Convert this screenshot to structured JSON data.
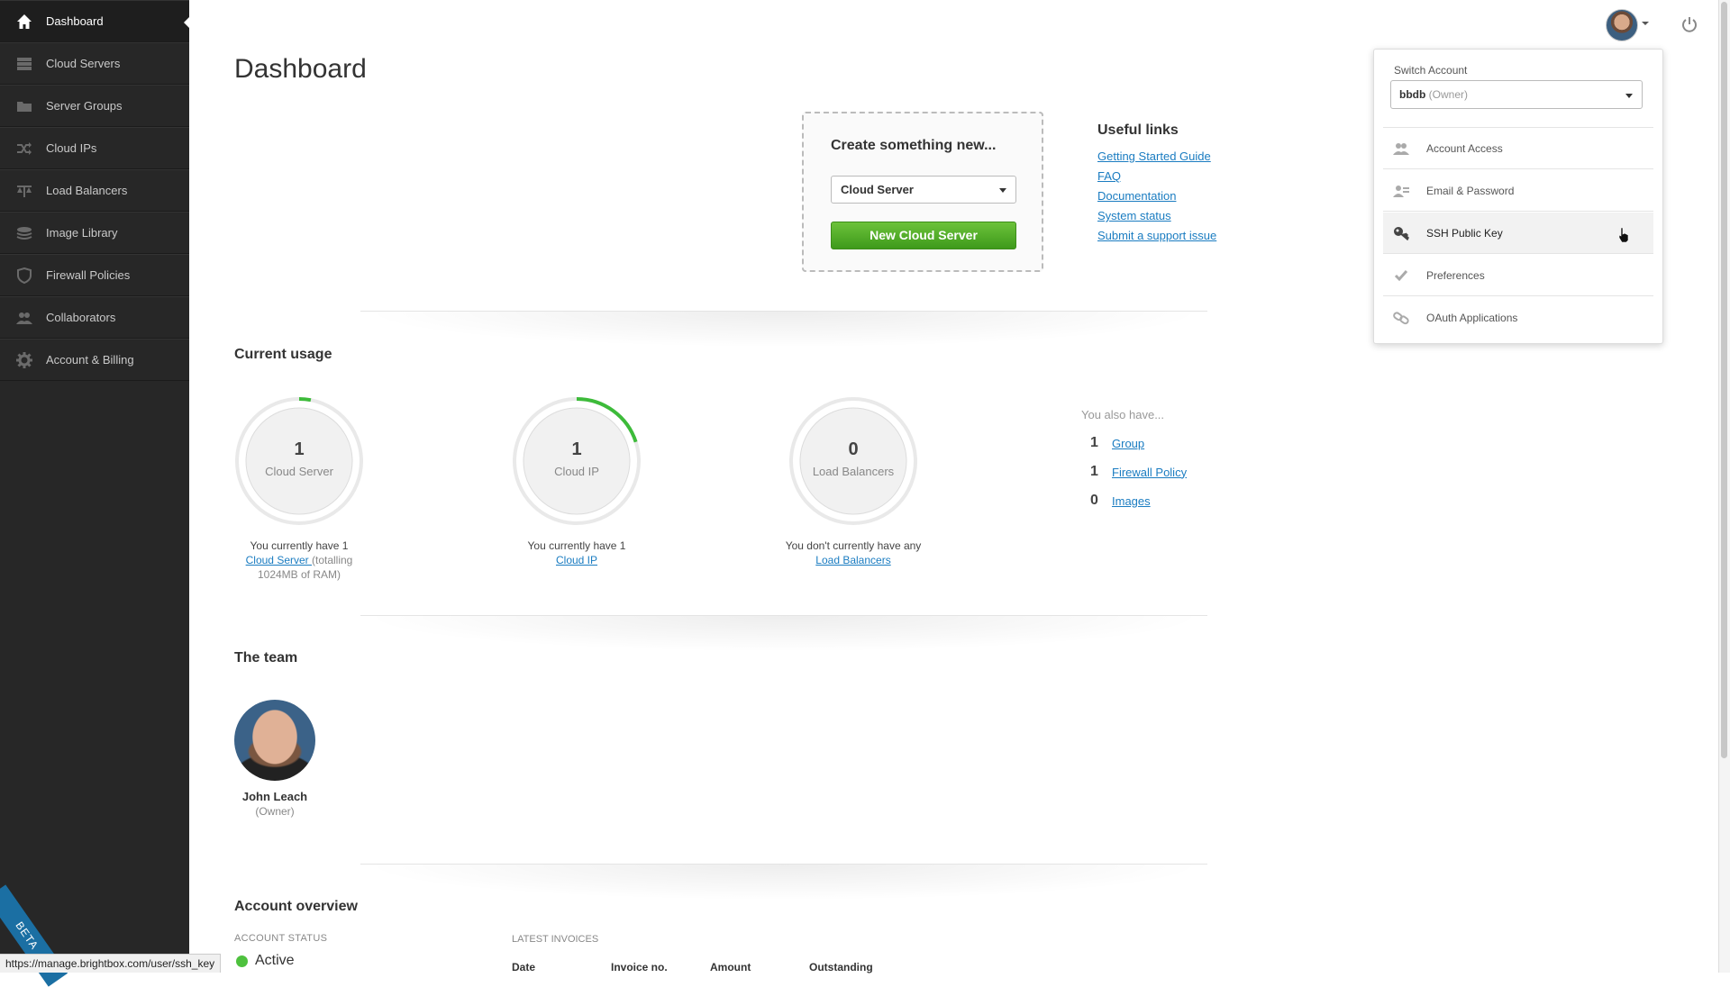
{
  "sidebar": {
    "items": [
      {
        "label": "Dashboard",
        "icon": "home-icon"
      },
      {
        "label": "Cloud Servers",
        "icon": "server-stack-icon"
      },
      {
        "label": "Server Groups",
        "icon": "folder-icon"
      },
      {
        "label": "Cloud IPs",
        "icon": "shuffle-icon"
      },
      {
        "label": "Load Balancers",
        "icon": "balance-icon"
      },
      {
        "label": "Image Library",
        "icon": "layers-icon"
      },
      {
        "label": "Firewall Policies",
        "icon": "shield-icon"
      },
      {
        "label": "Collaborators",
        "icon": "users-icon"
      },
      {
        "label": "Account & Billing",
        "icon": "gear-icon"
      }
    ],
    "beta": "BETA",
    "status_url": "https://manage.brightbox.com/user/ssh_key"
  },
  "page": {
    "title": "Dashboard"
  },
  "create": {
    "title": "Create something new...",
    "selected": "Cloud Server",
    "button": "New Cloud Server"
  },
  "useful_links": {
    "title": "Useful links",
    "links": [
      "Getting Started Guide",
      "FAQ",
      "Documentation",
      "System status",
      "Submit a support issue"
    ]
  },
  "usage": {
    "title": "Current usage",
    "items": [
      {
        "count": "1",
        "label": "Cloud Server",
        "fill": 0.03,
        "desc_pre": "You currently have 1",
        "desc_link": "Cloud Server ",
        "desc_post": "(totalling 1024MB of RAM)"
      },
      {
        "count": "1",
        "label": "Cloud IP",
        "fill": 0.2,
        "desc_pre": "You currently have 1",
        "desc_link": "Cloud IP",
        "desc_post": ""
      },
      {
        "count": "0",
        "label": "Load Balancers",
        "fill": 0,
        "desc_pre": "You don't currently have any",
        "desc_link": "Load Balancers",
        "desc_post": ""
      }
    ],
    "also_title": "You also have...",
    "also": [
      {
        "n": "1",
        "label": "Group"
      },
      {
        "n": "1",
        "label": "Firewall Policy"
      },
      {
        "n": "0",
        "label": "Images"
      }
    ]
  },
  "team": {
    "title": "The team",
    "members": [
      {
        "name": "John Leach",
        "role": "(Owner)"
      }
    ]
  },
  "account": {
    "title": "Account overview",
    "status_label": "ACCOUNT STATUS",
    "status": "Active",
    "invoices_label": "LATEST INVOICES",
    "invoice_columns": [
      "Date",
      "Invoice no.",
      "Amount",
      "Outstanding"
    ]
  },
  "menu": {
    "switch_label": "Switch Account",
    "account": "bbdb",
    "account_role": "(Owner)",
    "items": [
      {
        "label": "Account Access",
        "icon": "users-icon"
      },
      {
        "label": "Email & Password",
        "icon": "user-edit-icon"
      },
      {
        "label": "SSH Public Key",
        "icon": "key-icon"
      },
      {
        "label": "Preferences",
        "icon": "check-icon"
      },
      {
        "label": "OAuth Applications",
        "icon": "link-icon"
      }
    ]
  },
  "colors": {
    "sidebar_bg": "#272727",
    "accent_green": "#4ec13e",
    "link_blue": "#1a7cc1"
  }
}
